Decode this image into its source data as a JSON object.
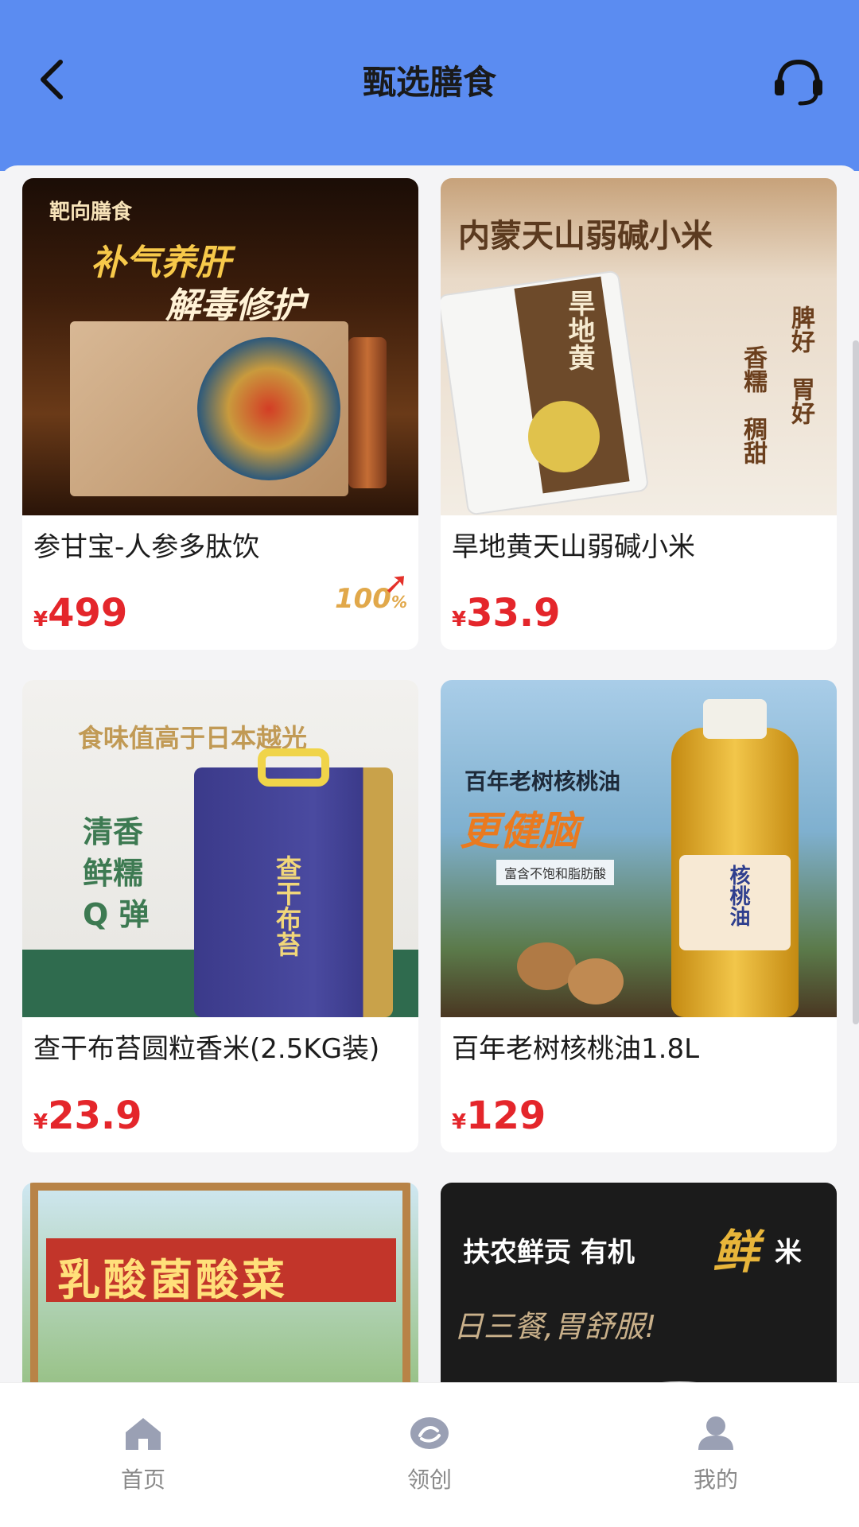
{
  "header": {
    "title": "甄选膳食",
    "back_icon": "back-arrow-icon",
    "service_icon": "customer-service-icon",
    "bg_color": "#5b8cf1"
  },
  "products_left": [
    {
      "name": "参甘宝-人参多肽饮",
      "currency": "¥",
      "price": "499",
      "badge": "100",
      "badge_unit": "%",
      "image_text": [
        "靶向膳食",
        "补气养肝",
        "解毒修护"
      ]
    },
    {
      "name": "查干布苔圆粒香米(2.5KG装)",
      "currency": "¥",
      "price": "23.9",
      "image_text": [
        "食味值高于日本越光",
        "清香",
        "鲜糯",
        "Q 弹",
        "查干布苔"
      ]
    },
    {
      "name": "",
      "image_text": [
        "乳酸菌酸菜"
      ]
    }
  ],
  "products_right": [
    {
      "name": "旱地黄天山弱碱小米",
      "currency": "¥",
      "price": "33.9",
      "image_text": [
        "内蒙天山弱碱小米",
        "旱地黄",
        "脾好",
        "胃好",
        "香糯",
        "稠甜"
      ]
    },
    {
      "name": "百年老树核桃油1.8L",
      "currency": "¥",
      "price": "129",
      "image_text": [
        "百年老树核桃油",
        "更健脑",
        "富含不饱和脂肪酸",
        "核桃油"
      ]
    },
    {
      "name": "",
      "image_text": [
        "扶农鲜贡 有机",
        "鲜",
        "米",
        "日三餐,胃舒服!"
      ]
    }
  ],
  "tabbar": {
    "items": [
      {
        "label": "首页",
        "icon": "home-icon"
      },
      {
        "label": "领创",
        "icon": "lingchuang-icon"
      },
      {
        "label": "我的",
        "icon": "profile-icon"
      }
    ]
  },
  "colors": {
    "price": "#e4262b",
    "tab_icon": "#9aa0b4"
  }
}
